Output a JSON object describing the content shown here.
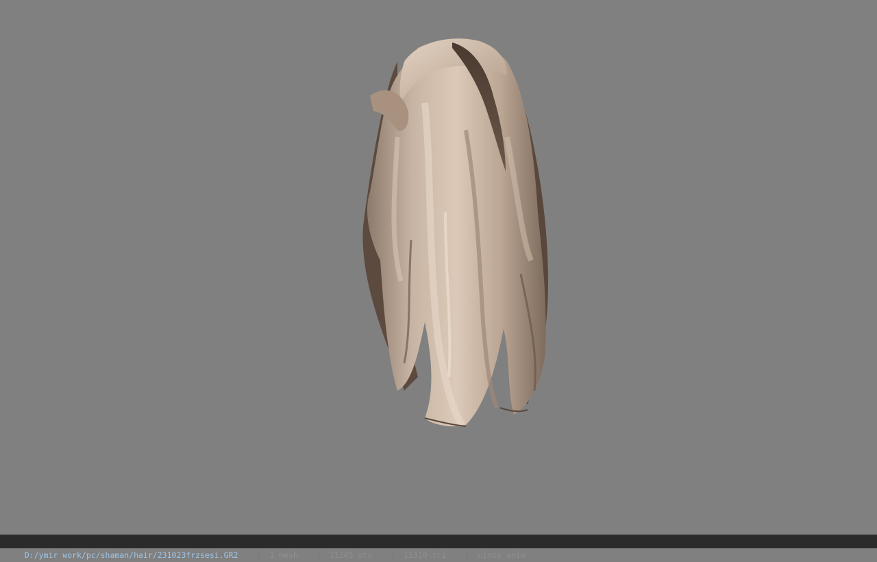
{
  "viewport": {
    "background": "#808080",
    "model_icon": "hair-mesh"
  },
  "statusbar": {
    "file_path": "D:/ymir work/pc/shaman/hair/231023frzsesi.GR2",
    "separator": "|",
    "mesh_count": "1 mesh",
    "vertex_count": "11245 vtx",
    "triangle_count": "15310 tri",
    "animation": "nincs anim",
    "path_color": "#9cc4e6",
    "text_color": "#8f8f8f",
    "background": "#2b2b2b"
  }
}
